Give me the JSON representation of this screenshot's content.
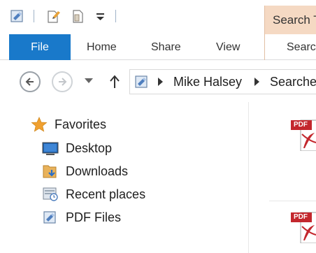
{
  "title_bar": {
    "context_tab": "Search T",
    "qat_icons": [
      "properties-icon",
      "new-folder-icon",
      "new-file-icon",
      "customize-qat-icon"
    ]
  },
  "ribbon": {
    "tabs": [
      "File",
      "Home",
      "Share",
      "View",
      "Searc"
    ]
  },
  "address_bar": {
    "breadcrumbs": [
      "Mike Halsey",
      "Searche"
    ]
  },
  "nav_pane": {
    "section": "Favorites",
    "items": [
      "Desktop",
      "Downloads",
      "Recent places",
      "PDF Files"
    ]
  },
  "files": {
    "badge": "PDF"
  },
  "colors": {
    "file_tab": "#1979ca",
    "context_tab": "#f5d9c3",
    "pdf_red": "#c3272d",
    "favorites_star": "#f0a030"
  }
}
